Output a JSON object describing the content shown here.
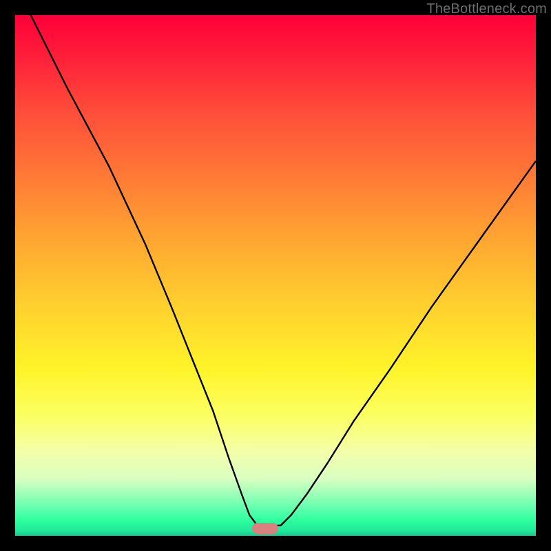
{
  "watermark": "TheBottleneck.com",
  "chart_data": {
    "type": "line",
    "title": "",
    "xlabel": "",
    "ylabel": "",
    "xlim": [
      0,
      100
    ],
    "ylim": [
      0,
      100
    ],
    "grid": false,
    "legend": false,
    "series": [
      {
        "name": "bottleneck-curve",
        "x": [
          3,
          10,
          18,
          25,
          30,
          34,
          38,
          41,
          43.5,
          45,
          46.5,
          48,
          51,
          53,
          56,
          60,
          65,
          72,
          80,
          90,
          100
        ],
        "values": [
          100,
          86,
          71,
          56,
          44,
          34,
          24,
          15,
          8,
          4,
          2,
          2,
          2,
          4,
          8,
          14,
          22,
          32,
          44,
          58,
          72
        ]
      }
    ],
    "marker": {
      "x": 48,
      "y": 1.5
    }
  },
  "colors": {
    "curve": "#000000",
    "marker": "#d98080",
    "frame": "#000000"
  }
}
